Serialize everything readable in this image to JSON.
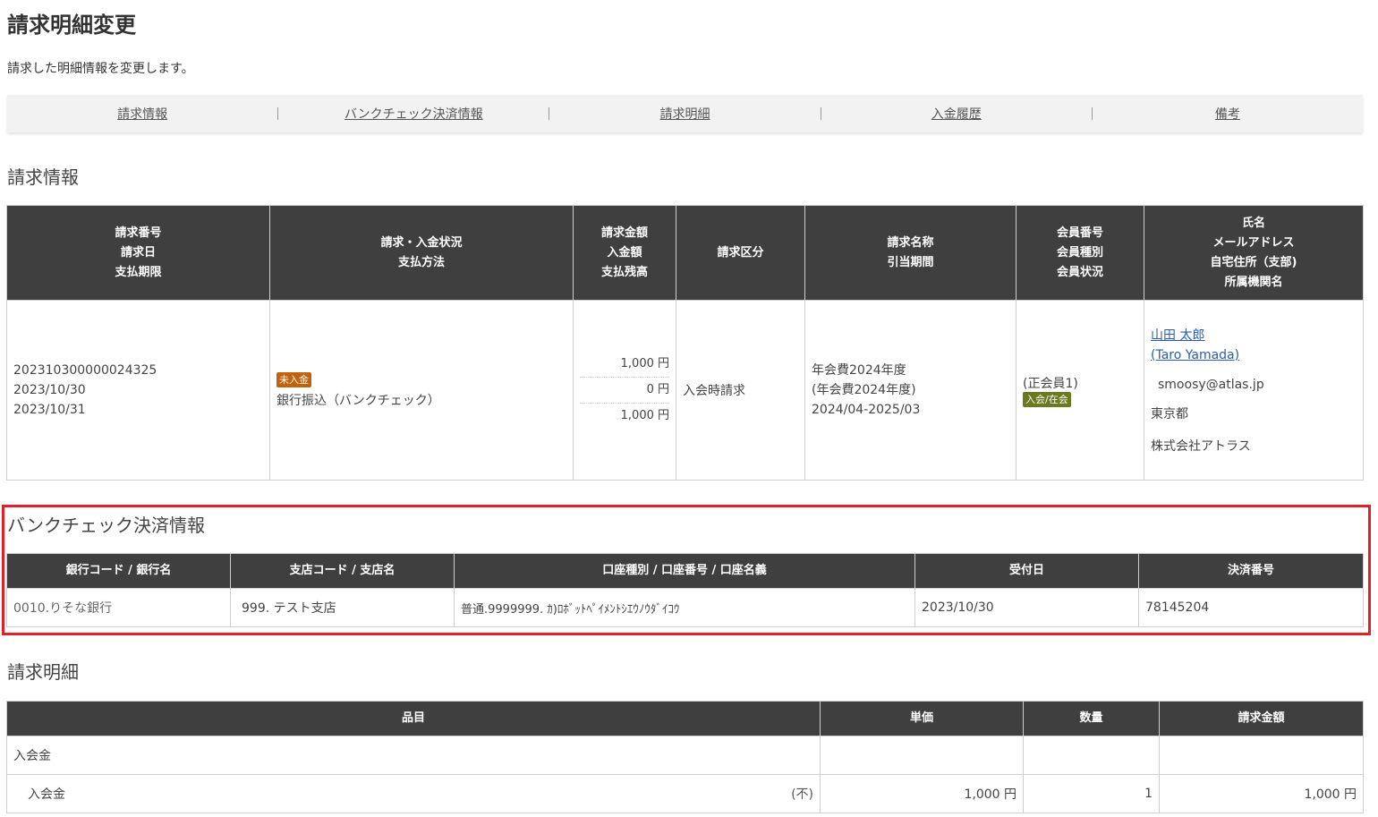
{
  "header": {
    "title": "請求明細変更",
    "description": "請求した明細情報を変更します。"
  },
  "anchor_nav": [
    {
      "label": "請求情報"
    },
    {
      "label": "バンクチェック決済情報"
    },
    {
      "label": "請求明細"
    },
    {
      "label": "入金履歴"
    },
    {
      "label": "備考"
    }
  ],
  "invoice_info": {
    "section_title": "請求情報",
    "headers": {
      "col1": [
        "請求番号",
        "請求日",
        "支払期限"
      ],
      "col2": [
        "請求・入金状況",
        "支払方法"
      ],
      "col3": [
        "請求金額",
        "入金額",
        "支払残高"
      ],
      "col4": [
        "請求区分"
      ],
      "col5": [
        "請求名称",
        "引当期間"
      ],
      "col6": [
        "会員番号",
        "会員種別",
        "会員状況"
      ],
      "col7": [
        "氏名",
        "メールアドレス",
        "自宅住所（支部)",
        "所属機関名"
      ]
    },
    "row": {
      "invoice_number": "202310300000024325",
      "invoice_date": "2023/10/30",
      "due_date": "2023/10/31",
      "status_badge": "未入金",
      "payment_method": "銀行振込（バンクチェック）",
      "amount_billed": "1,000 円",
      "amount_paid": "0 円",
      "balance": "1,000 円",
      "category": "入会時請求",
      "name_line1": "年会費2024年度",
      "name_line2": "(年会費2024年度)",
      "period": "2024/04-2025/03",
      "member_type": "(正会員1)",
      "member_status_badge": "入会/在会",
      "person_name": "山田 太郎",
      "person_name_en": "(Taro Yamada)",
      "email": "smoosy@atlas.jp",
      "address": "東京都",
      "organization": "株式会社アトラス"
    },
    "colors": {
      "status_unpaid": "#c0620e",
      "status_member": "#6b7a1e"
    }
  },
  "bankcheck": {
    "section_title": "バンクチェック決済情報",
    "headers": [
      "銀行コード / 銀行名",
      "支店コード / 支店名",
      "口座種別 / 口座番号 / 口座名義",
      "受付日",
      "決済番号"
    ],
    "row": [
      "0010.りそな銀行",
      "999. テスト支店",
      "普通.9999999. ｶ)ﾛﾎﾞｯﾄﾍﾟｲﾒﾝﾄｼｴｳﾉｳﾀﾞｲｺｳ",
      "2023/10/30",
      "78145204"
    ],
    "highlight_color": "#e0202a"
  },
  "details": {
    "section_title": "請求明細",
    "headers": [
      "品目",
      "単価",
      "数量",
      "請求金額"
    ],
    "group_label": "入会金",
    "item": {
      "label": "入会金",
      "tax": "(不)",
      "unit_price": "1,000 円",
      "qty": "1",
      "amount": "1,000 円"
    }
  }
}
